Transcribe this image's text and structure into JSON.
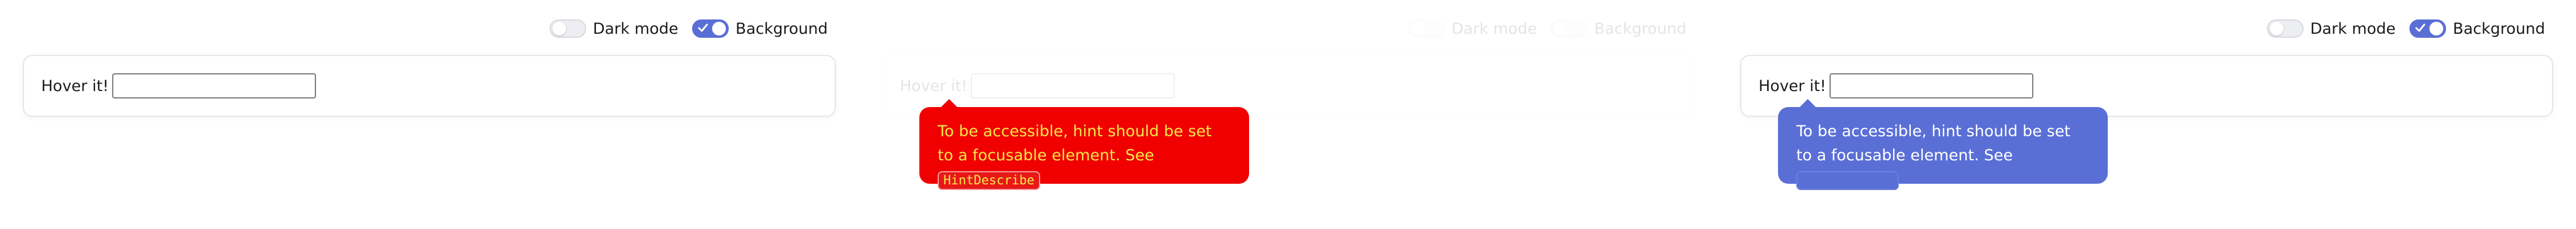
{
  "toggles": {
    "dark_mode": {
      "label": "Dark mode",
      "checked": false
    },
    "background": {
      "label": "Background",
      "checked": true
    }
  },
  "card": {
    "label": "Hover it!",
    "input_value": ""
  },
  "tooltip": {
    "text": "To be accessible, hint should be set to a focusable element. See",
    "code": "HintDescribe"
  },
  "colors": {
    "accent": "#5a6fd6",
    "warning_bg": "#f00000",
    "warning_text": "#f4e84a"
  }
}
